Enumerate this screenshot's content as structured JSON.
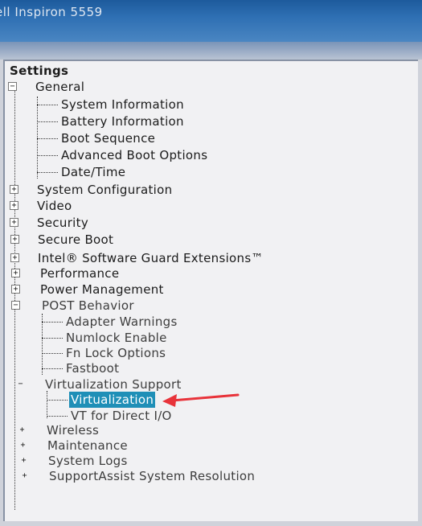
{
  "window": {
    "title": "ell Inspiron 5559"
  },
  "tree": {
    "root_label": "Settings",
    "general": {
      "label": "General",
      "children": [
        "System Information",
        "Battery Information",
        "Boot Sequence",
        "Advanced Boot Options",
        "Date/Time"
      ]
    },
    "sections": [
      "System Configuration",
      "Video",
      "Security",
      "Secure Boot",
      "Intel® Software Guard Extensions™",
      "Performance",
      "Power Management"
    ],
    "post_behavior": {
      "label": "POST Behavior",
      "children": [
        "Adapter Warnings",
        "Numlock Enable",
        "Fn Lock Options",
        "Fastboot"
      ]
    },
    "virtualization_support": {
      "label": "Virtualization Support",
      "children": [
        "Virtualization",
        "VT for Direct I/O"
      ],
      "selected": "Virtualization"
    },
    "trailing_sections": [
      "Wireless",
      "Maintenance",
      "System Logs",
      "SupportAssist System Resolution"
    ],
    "expanded_symbol": "−",
    "collapsed_symbol": "+"
  },
  "annotation": {
    "arrow_color": "#e8333a"
  },
  "colors": {
    "selection": "#1f8fb7",
    "titlebar": "#2e6fb3"
  }
}
